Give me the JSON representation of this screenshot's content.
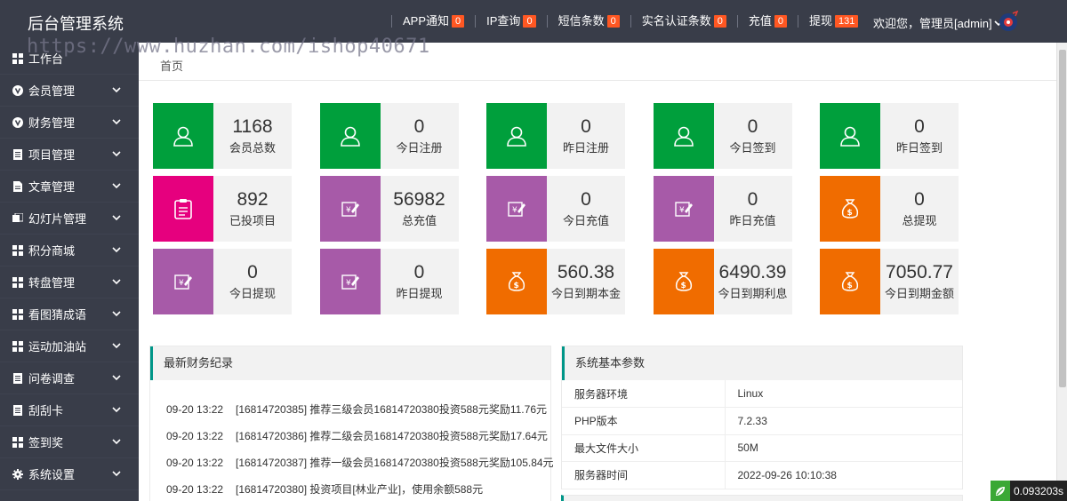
{
  "header": {
    "title": "后台管理系统",
    "nav": [
      {
        "label": "APP通知",
        "count": "0"
      },
      {
        "label": "IP查询",
        "count": "0"
      },
      {
        "label": "短信条数",
        "count": "0"
      },
      {
        "label": "实名认证条数",
        "count": "0"
      },
      {
        "label": "充值",
        "count": "0"
      },
      {
        "label": "提现",
        "count": "131"
      }
    ],
    "welcome": "欢迎您，管理员[admin]"
  },
  "watermark": "https://www.huzhan.com/ishop40671",
  "sidebar": {
    "items": [
      {
        "label": "工作台",
        "icon": "grid-icon",
        "has_sub": false
      },
      {
        "label": "会员管理",
        "icon": "v-circle-icon",
        "has_sub": true
      },
      {
        "label": "财务管理",
        "icon": "v-circle-icon",
        "has_sub": true
      },
      {
        "label": "项目管理",
        "icon": "list-icon",
        "has_sub": true
      },
      {
        "label": "文章管理",
        "icon": "document-icon",
        "has_sub": true
      },
      {
        "label": "幻灯片管理",
        "icon": "slides-icon",
        "has_sub": true
      },
      {
        "label": "积分商城",
        "icon": "grid-icon",
        "has_sub": true
      },
      {
        "label": "转盘管理",
        "icon": "grid-icon",
        "has_sub": true
      },
      {
        "label": "看图猜成语",
        "icon": "grid-icon",
        "has_sub": true
      },
      {
        "label": "运动加油站",
        "icon": "grid-icon",
        "has_sub": true
      },
      {
        "label": "问卷调查",
        "icon": "list-icon",
        "has_sub": true
      },
      {
        "label": "刮刮卡",
        "icon": "list-icon",
        "has_sub": true
      },
      {
        "label": "签到奖",
        "icon": "grid-icon",
        "has_sub": true
      },
      {
        "label": "系统设置",
        "icon": "gear-icon",
        "has_sub": true
      }
    ]
  },
  "breadcrumb": "首页",
  "cards": [
    {
      "value": "1168",
      "label": "会员总数",
      "color": "#009f3c",
      "icon": "user-icon"
    },
    {
      "value": "0",
      "label": "今日注册",
      "color": "#009f3c",
      "icon": "user-icon"
    },
    {
      "value": "0",
      "label": "昨日注册",
      "color": "#009f3c",
      "icon": "user-icon"
    },
    {
      "value": "0",
      "label": "今日签到",
      "color": "#009f3c",
      "icon": "user-icon"
    },
    {
      "value": "0",
      "label": "昨日签到",
      "color": "#009f3c",
      "icon": "user-icon"
    },
    {
      "value": "892",
      "label": "已投项目",
      "color": "#e6007e",
      "icon": "clipboard-icon"
    },
    {
      "value": "56982",
      "label": "总充值",
      "color": "#a75aa8",
      "icon": "yen-edit-icon"
    },
    {
      "value": "0",
      "label": "今日充值",
      "color": "#a75aa8",
      "icon": "yen-edit-icon"
    },
    {
      "value": "0",
      "label": "昨日充值",
      "color": "#a75aa8",
      "icon": "yen-edit-icon"
    },
    {
      "value": "0",
      "label": "总提现",
      "color": "#f06c00",
      "icon": "money-bag-icon"
    },
    {
      "value": "0",
      "label": "今日提现",
      "color": "#a75aa8",
      "icon": "yen-edit-icon"
    },
    {
      "value": "0",
      "label": "昨日提现",
      "color": "#a75aa8",
      "icon": "yen-edit-icon"
    },
    {
      "value": "560.38",
      "label": "今日到期本金",
      "color": "#f06c00",
      "icon": "money-bag-icon"
    },
    {
      "value": "6490.39",
      "label": "今日到期利息",
      "color": "#f06c00",
      "icon": "money-bag-icon"
    },
    {
      "value": "7050.77",
      "label": "今日到期金额",
      "color": "#f06c00",
      "icon": "money-bag-icon"
    }
  ],
  "finance": {
    "title": "最新财务纪录",
    "records": [
      {
        "time": "09-20 13:22",
        "text": "[16814720385] 推荐三级会员16814720380投资588元奖励11.76元"
      },
      {
        "time": "09-20 13:22",
        "text": "[16814720386] 推荐二级会员16814720380投资588元奖励17.64元"
      },
      {
        "time": "09-20 13:22",
        "text": "[16814720387] 推荐一级会员16814720380投资588元奖励105.84元"
      },
      {
        "time": "09-20 13:22",
        "text": "[16814720380] 投资项目[林业产业]，使用余额588元"
      }
    ]
  },
  "system": {
    "title": "系统基本参数",
    "rows": [
      {
        "key": "服务器环境",
        "value": "Linux"
      },
      {
        "key": "PHP版本",
        "value": "7.2.33"
      },
      {
        "key": "最大文件大小",
        "value": "50M"
      },
      {
        "key": "服务器时间",
        "value": "2022-09-26 10:10:38"
      }
    ]
  },
  "timer": "0.093203s"
}
